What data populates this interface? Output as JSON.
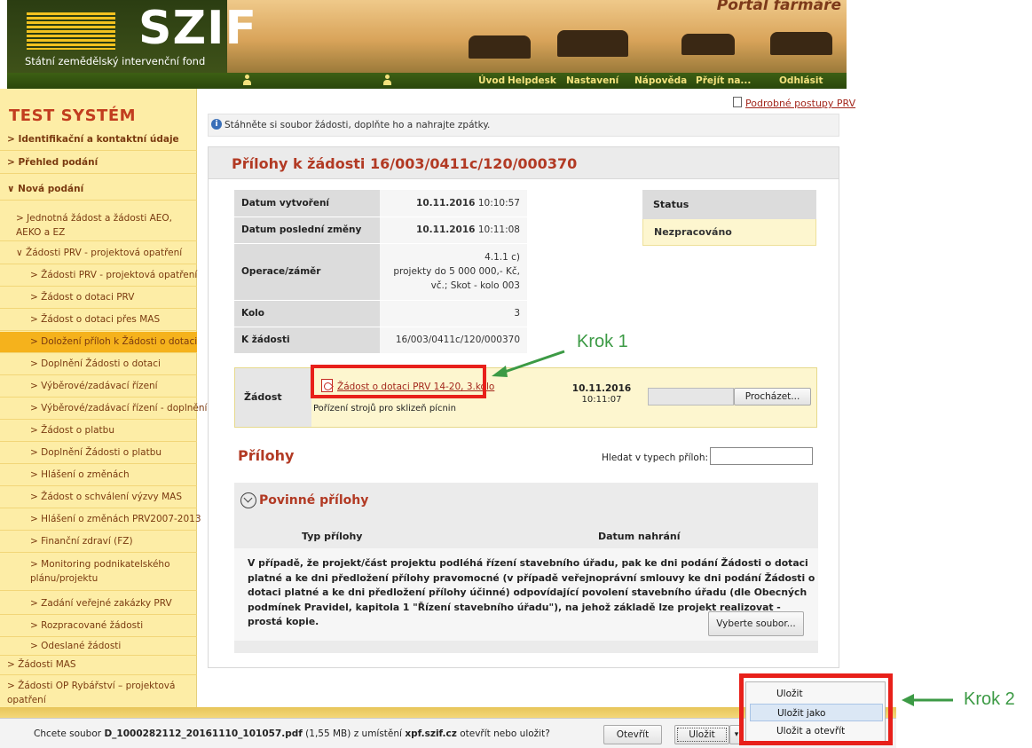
{
  "header": {
    "logo_text": "SZIF",
    "logo_subtitle": "Státní zemědělský intervenční fond",
    "portal_title": "Portál farmáře",
    "nav": [
      "Úvod",
      "Helpdesk",
      "Nastavení",
      "Nápověda",
      "Přejít na...",
      "Odhlásit"
    ]
  },
  "sidebar": {
    "title": "TEST SYSTÉM",
    "items": [
      {
        "label": "> Identifikační a kontaktní údaje"
      },
      {
        "label": "> Přehled podání"
      },
      {
        "label": "∨ Nová podání"
      },
      {
        "label": "> Jednotná žádost a žádosti AEO, AEKO a EZ"
      },
      {
        "label": "∨ Žádosti PRV - projektová opatření"
      },
      {
        "label": "> Žádosti PRV - projektová opatření"
      },
      {
        "label": "> Žádost o dotaci PRV"
      },
      {
        "label": "> Žádost o dotaci přes MAS"
      },
      {
        "label": "> Doložení příloh k Žádosti o dotaci"
      },
      {
        "label": "> Doplnění Žádosti o dotaci"
      },
      {
        "label": "> Výběrové/zadávací řízení"
      },
      {
        "label": "> Výběrové/zadávací řízení - doplnění"
      },
      {
        "label": "> Žádost o platbu"
      },
      {
        "label": "> Doplnění Žádosti o platbu"
      },
      {
        "label": "> Hlášení o změnách"
      },
      {
        "label": "> Žádost o schválení výzvy MAS"
      },
      {
        "label": "> Hlášení o změnách PRV2007-2013"
      },
      {
        "label": "> Finanční zdraví (FZ)"
      },
      {
        "label": "> Monitoring podnikatelského plánu/projektu"
      },
      {
        "label": "> Zadání veřejné zakázky PRV"
      },
      {
        "label": "> Rozpracované žádosti"
      },
      {
        "label": "> Odeslané žádosti"
      },
      {
        "label": "> Žádosti MAS"
      },
      {
        "label": "> Žádosti OP Rybářství – projektová opatření"
      }
    ]
  },
  "help_link": "Podrobné postupy PRV",
  "info_message": "Stáhněte si soubor žádosti, doplňte ho a nahrajte zpátky.",
  "page_title": "Přílohy k žádosti 16/003/0411c/120/000370",
  "details": {
    "created_label": "Datum vytvoření",
    "created_date": "10.11.2016",
    "created_time": "10:10:57",
    "modified_label": "Datum poslední změny",
    "modified_date": "10.11.2016",
    "modified_time": "10:11:08",
    "operation_label": "Operace/záměr",
    "operation_line1": "4.1.1 c)",
    "operation_line2": "projekty do 5 000 000,- Kč,",
    "operation_line3": "vč.; Skot - kolo 003",
    "round_label": "Kolo",
    "round_value": "3",
    "request_label": "K žádosti",
    "request_value": "16/003/0411c/120/000370"
  },
  "status": {
    "label": "Status",
    "value": "Nezpracováno"
  },
  "zadost": {
    "label": "Žádost",
    "link": "Žádost o dotaci PRV 14-20, 3.kolo",
    "description": "Pořízení strojů pro sklizeň pícnin",
    "date": "10.11.2016",
    "time": "10:11:07",
    "browse": "Procházet..."
  },
  "attachments": {
    "title": "Přílohy",
    "search_label": "Hledat v typech příloh:",
    "search_value": "",
    "required_title": "Povinné přílohy",
    "col_type": "Typ přílohy",
    "col_date": "Datum nahrání",
    "requirement_text": "V případě, že projekt/část projektu podléhá řízení stavebního úřadu, pak ke dni podání Žádosti o dotaci platné a ke dni předložení přílohy pravomocné (v případě veřejnoprávní smlouvy ke dni podání Žádosti o dotaci platné a ke dni předložení přílohy účinné) odpovídající povolení stavebního úřadu (dle Obecných podmínek Pravidel, kapitola 1 \"Řízení stavebního úřadu\"), na jehož základě lze projekt realizovat - prostá kopie.",
    "select_file": "Vyberte soubor..."
  },
  "annotations": {
    "step1": "Krok 1",
    "step2": "Krok 2"
  },
  "download_bar": {
    "prefix": "Chcete soubor ",
    "filename": "D_1000282112_20161110_101057.pdf",
    "size": " (1,55 MB) z umístění ",
    "host": "xpf.szif.cz",
    "suffix": " otevřít nebo uložit?",
    "open": "Otevřít",
    "save": "Uložit",
    "dropdown_arrow": "▾",
    "menu": [
      "Uložit",
      "Uložit jako",
      "Uložit a otevřít"
    ]
  },
  "colors": {
    "accent_red": "#e8201a",
    "arrow_green": "#3c9a45",
    "nav_green": "#2a470b",
    "sidebar_yellow": "#fdeda6"
  }
}
